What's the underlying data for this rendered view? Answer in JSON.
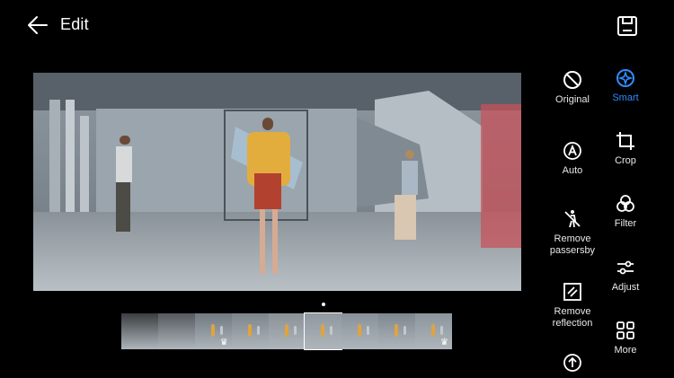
{
  "header": {
    "title": "Edit",
    "back_icon": "arrow-left-icon",
    "save_icon": "save-icon"
  },
  "photo": {
    "description_icon": "photo-preview"
  },
  "filmstrip": {
    "frames": [
      {
        "crown": false
      },
      {
        "crown": false
      },
      {
        "crown": true
      },
      {
        "crown": false
      },
      {
        "crown": false
      },
      {
        "crown": false
      },
      {
        "crown": false
      },
      {
        "crown": false
      },
      {
        "crown": true
      }
    ],
    "selected_index": 5
  },
  "tools": {
    "col1": [
      {
        "label": "Original",
        "icon": "no-entry-icon"
      },
      {
        "label": "Auto",
        "icon": "auto-enhance-icon"
      },
      {
        "label": "Remove passersby",
        "icon": "remove-passersby-icon"
      },
      {
        "label": "Remove reflection",
        "icon": "remove-reflection-icon"
      },
      {
        "label": "",
        "icon": "upload-circle-icon"
      }
    ],
    "col2": [
      {
        "label": "Smart",
        "icon": "smart-icon",
        "active": true
      },
      {
        "label": "Crop",
        "icon": "crop-icon"
      },
      {
        "label": "Filter",
        "icon": "filter-icon"
      },
      {
        "label": "Adjust",
        "icon": "sliders-icon"
      },
      {
        "label": "More",
        "icon": "grid-more-icon"
      }
    ]
  },
  "colors": {
    "accent": "#2f8cff",
    "background": "#000000",
    "text": "#ffffff"
  }
}
